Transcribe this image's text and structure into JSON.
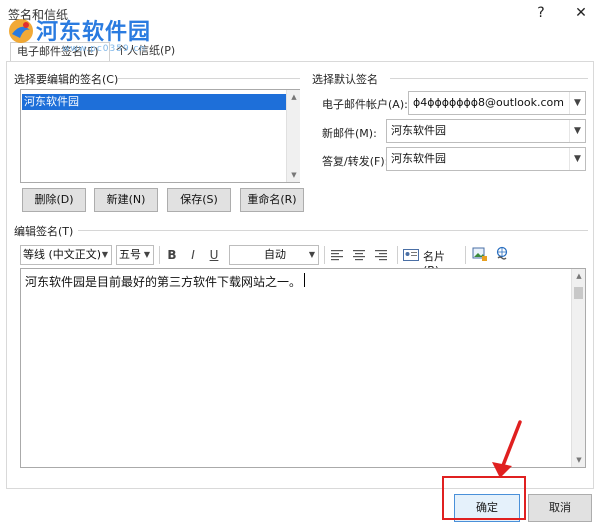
{
  "window": {
    "title": "签名和信纸",
    "help_label": "?",
    "close_label": "✕"
  },
  "watermark": {
    "name": "河东软件园",
    "url": "www.pc0359.cn"
  },
  "tabs": [
    {
      "label": "电子邮件签名(E)"
    },
    {
      "label": "个人信纸(P)"
    }
  ],
  "signature_list": {
    "section_label": "选择要编辑的签名(C)",
    "items": [
      "河东软件园"
    ],
    "buttons": {
      "delete": "删除(D)",
      "new": "新建(N)",
      "save": "保存(S)",
      "rename": "重命名(R)"
    }
  },
  "default_signature": {
    "section_label": "选择默认签名",
    "account_label": "电子邮件帐户(A):",
    "account_value": "ɸ4ɸɸɸɸɸɸɸ8@outlook.com",
    "new_messages_label": "新邮件(M):",
    "new_messages_value": "河东软件园",
    "replies_label": "答复/转发(F):",
    "replies_value": "河东软件园"
  },
  "editor": {
    "section_label": "编辑签名(T)",
    "font_value": "等线 (中文正文)",
    "size_value": "五号",
    "bold": "B",
    "italic": "I",
    "underline": "U",
    "color_value": "自动",
    "business_card": "名片(B)",
    "content": "河东软件园是目前最好的第三方软件下载网站之一。"
  },
  "footer": {
    "ok_label": "确定",
    "cancel_label": "取消"
  },
  "colors": {
    "selection": "#1e6fd9",
    "highlight_box": "#e02020",
    "arrow": "#e02020",
    "watermark": "#2a7be0"
  }
}
